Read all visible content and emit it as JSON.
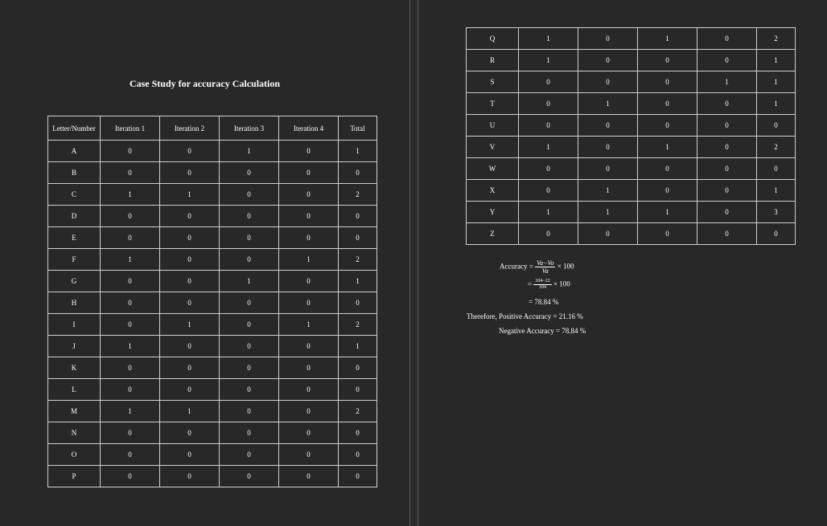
{
  "title": "Case Study for accuracy Calculation",
  "table": {
    "headers": [
      "Letter/Number",
      "Iteration 1",
      "Iteration 2",
      "Iteration 3",
      "Iteration 4",
      "Total"
    ],
    "rows_page1": [
      [
        "A",
        "0",
        "0",
        "1",
        "0",
        "1"
      ],
      [
        "B",
        "0",
        "0",
        "0",
        "0",
        "0"
      ],
      [
        "C",
        "1",
        "1",
        "0",
        "0",
        "2"
      ],
      [
        "D",
        "0",
        "0",
        "0",
        "0",
        "0"
      ],
      [
        "E",
        "0",
        "0",
        "0",
        "0",
        "0"
      ],
      [
        "F",
        "1",
        "0",
        "0",
        "1",
        "2"
      ],
      [
        "G",
        "0",
        "0",
        "1",
        "0",
        "1"
      ],
      [
        "H",
        "0",
        "0",
        "0",
        "0",
        "0"
      ],
      [
        "I",
        "0",
        "1",
        "0",
        "1",
        "2"
      ],
      [
        "J",
        "1",
        "0",
        "0",
        "0",
        "1"
      ],
      [
        "K",
        "0",
        "0",
        "0",
        "0",
        "0"
      ],
      [
        "L",
        "0",
        "0",
        "0",
        "0",
        "0"
      ],
      [
        "M",
        "1",
        "1",
        "0",
        "0",
        "2"
      ],
      [
        "N",
        "0",
        "0",
        "0",
        "0",
        "0"
      ],
      [
        "O",
        "0",
        "0",
        "0",
        "0",
        "0"
      ],
      [
        "P",
        "0",
        "0",
        "0",
        "0",
        "0"
      ]
    ],
    "rows_page2": [
      [
        "Q",
        "1",
        "0",
        "1",
        "0",
        "2"
      ],
      [
        "R",
        "1",
        "0",
        "0",
        "0",
        "1"
      ],
      [
        "S",
        "0",
        "0",
        "0",
        "1",
        "1"
      ],
      [
        "T",
        "0",
        "1",
        "0",
        "0",
        "1"
      ],
      [
        "U",
        "0",
        "0",
        "0",
        "0",
        "0"
      ],
      [
        "V",
        "1",
        "0",
        "1",
        "0",
        "2"
      ],
      [
        "W",
        "0",
        "0",
        "0",
        "0",
        "0"
      ],
      [
        "X",
        "0",
        "1",
        "0",
        "0",
        "1"
      ],
      [
        "Y",
        "1",
        "1",
        "1",
        "0",
        "3"
      ],
      [
        "Z",
        "0",
        "0",
        "0",
        "0",
        "0"
      ]
    ]
  },
  "calculation": {
    "accuracy_label": "Accuracy =",
    "formula_numerator": "Va−Vo",
    "formula_denominator": "Va",
    "times_100": "× 100",
    "eq_sign": "=",
    "sub_numerator": "104−22",
    "sub_denominator": "104",
    "result": "= 78.84 %",
    "positive_accuracy": "Therefore, Positive Accuracy = 21.16 %",
    "negative_accuracy": "Negative Accuracy = 78.84 %"
  }
}
